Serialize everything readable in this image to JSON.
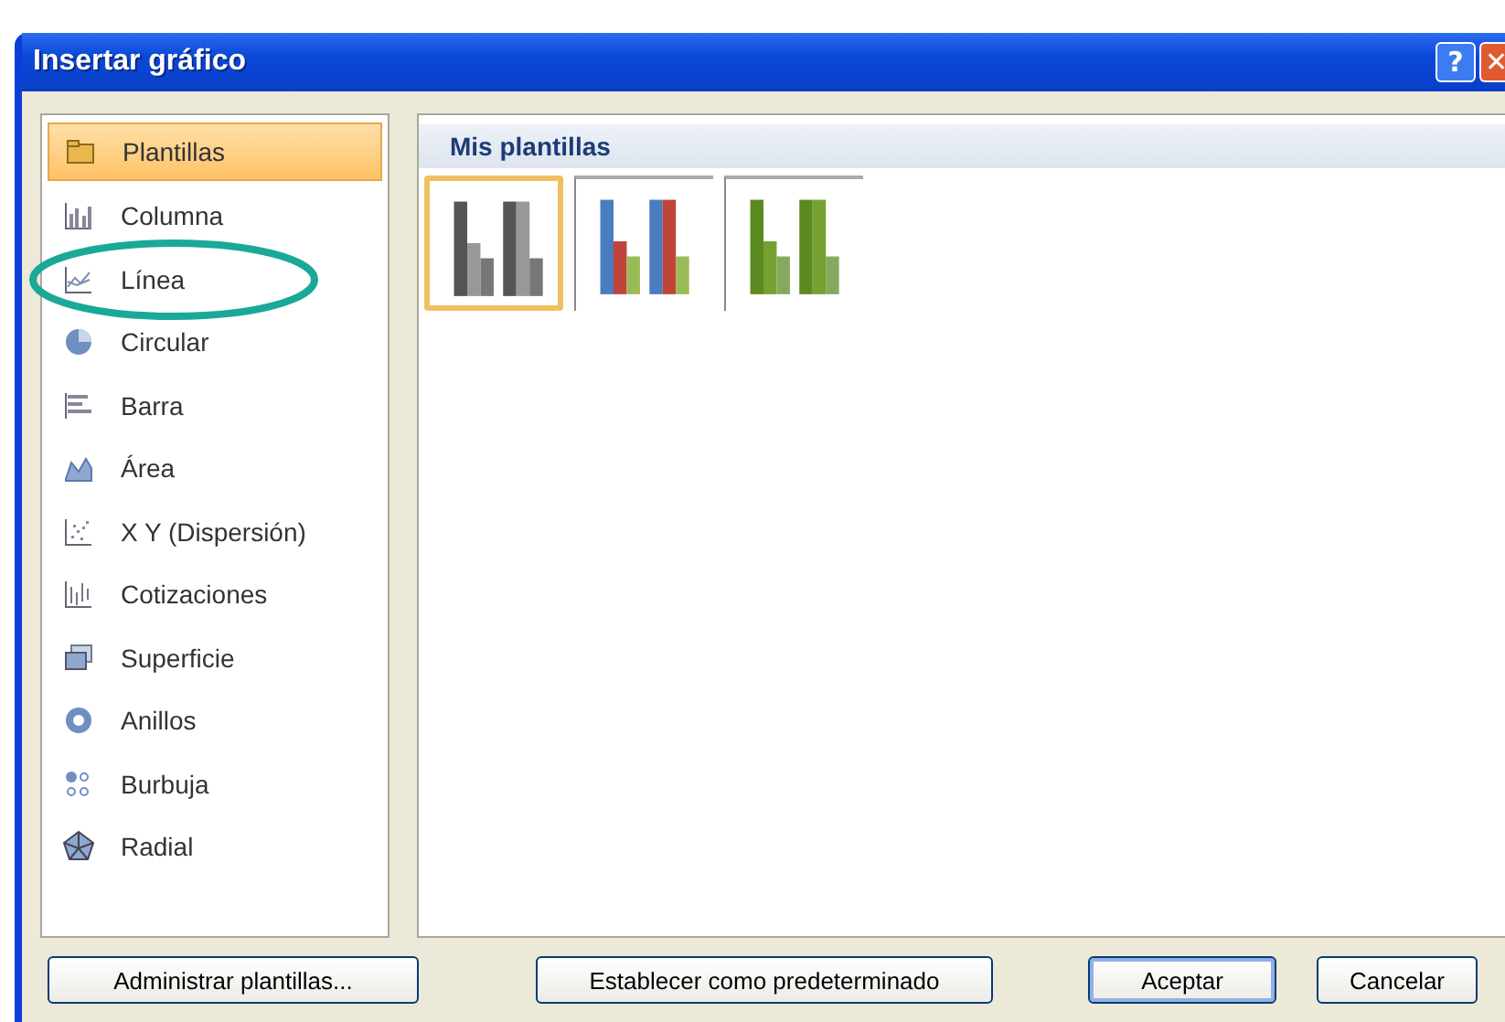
{
  "window": {
    "title": "Insertar gráfico"
  },
  "title_buttons": [
    {
      "kind": "help",
      "label": "?"
    },
    {
      "kind": "close",
      "label": "✕"
    }
  ],
  "sidebar": {
    "items": [
      {
        "kind": "folder",
        "label": "Plantillas",
        "selected": true
      },
      {
        "kind": "column",
        "label": "Columna",
        "selected": false
      },
      {
        "kind": "line",
        "label": "Línea",
        "selected": false,
        "circled": true
      },
      {
        "kind": "pie",
        "label": "Circular",
        "selected": false
      },
      {
        "kind": "bar",
        "label": "Barra",
        "selected": false
      },
      {
        "kind": "area",
        "label": "Área",
        "selected": false
      },
      {
        "kind": "scatter",
        "label": "X Y (Dispersión)",
        "selected": false
      },
      {
        "kind": "stock",
        "label": "Cotizaciones",
        "selected": false
      },
      {
        "kind": "surface",
        "label": "Superficie",
        "selected": false
      },
      {
        "kind": "doughnut",
        "label": "Anillos",
        "selected": false
      },
      {
        "kind": "bubble",
        "label": "Burbuja",
        "selected": false
      },
      {
        "kind": "radar",
        "label": "Radial",
        "selected": false
      }
    ]
  },
  "gallery": {
    "heading": "Mis plantillas",
    "templates": [
      {
        "kind": "gray",
        "selected": true
      },
      {
        "kind": "color",
        "selected": false
      },
      {
        "kind": "green",
        "selected": false
      }
    ]
  },
  "buttons": [
    {
      "label": "Administrar plantillas...",
      "default": false
    },
    {
      "label": "Establecer como predeterminado",
      "default": false
    },
    {
      "label": "Aceptar",
      "default": true
    },
    {
      "label": "Cancelar",
      "default": false
    }
  ]
}
